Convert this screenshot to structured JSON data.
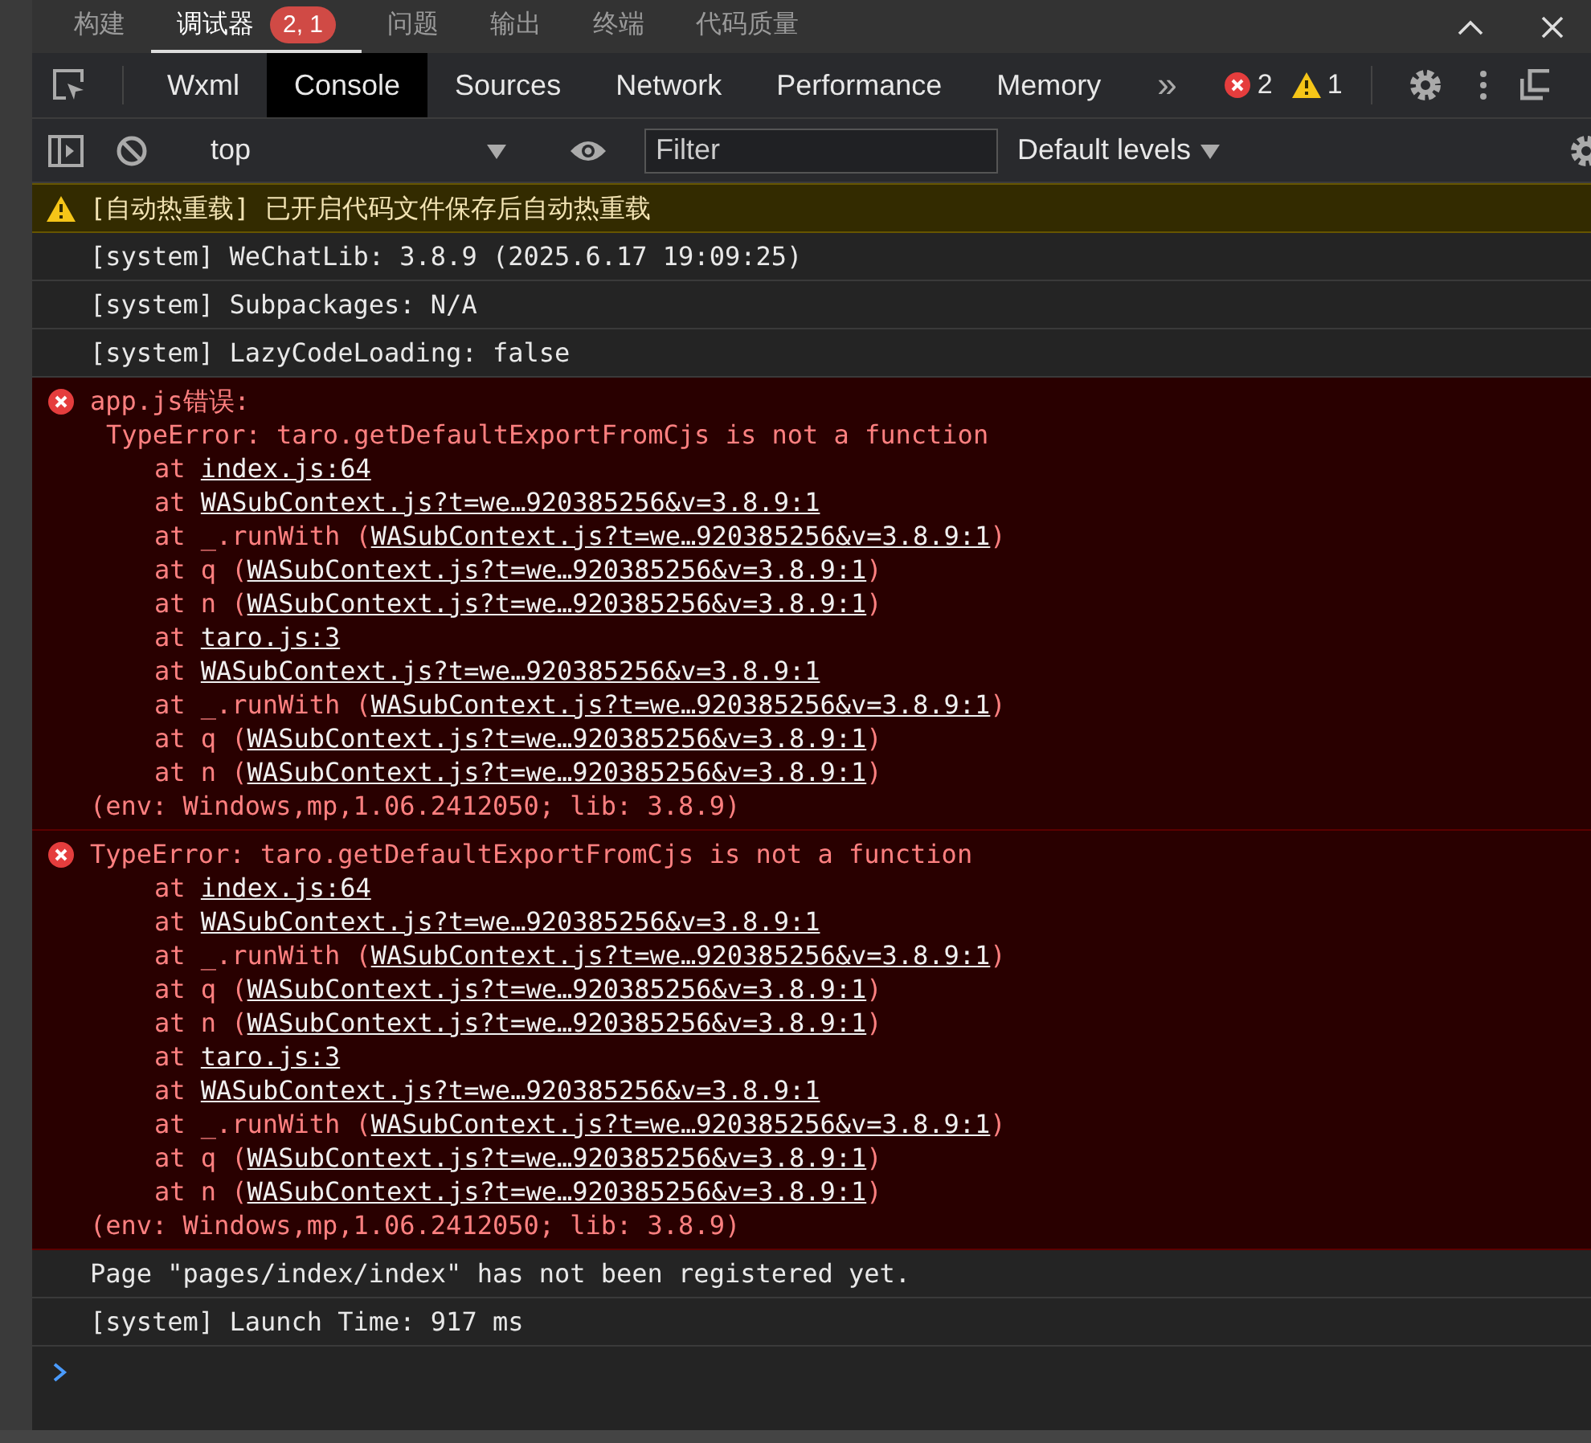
{
  "panel_tabs": [
    {
      "label": "构建",
      "selected": false
    },
    {
      "label": "调试器",
      "selected": true,
      "badge": "2, 1"
    },
    {
      "label": "问题",
      "selected": false
    },
    {
      "label": "输出",
      "selected": false
    },
    {
      "label": "终端",
      "selected": false
    },
    {
      "label": "代码质量",
      "selected": false
    }
  ],
  "devtools_tabs": [
    {
      "label": "Wxml",
      "selected": false
    },
    {
      "label": "Console",
      "selected": true
    },
    {
      "label": "Sources",
      "selected": false
    },
    {
      "label": "Network",
      "selected": false
    },
    {
      "label": "Performance",
      "selected": false
    },
    {
      "label": "Memory",
      "selected": false
    }
  ],
  "more_tabs": "»",
  "counts": {
    "errors": "2",
    "warnings": "1"
  },
  "console_toolbar": {
    "context": "top",
    "filter": {
      "placeholder": "Filter"
    },
    "levels": "Default levels"
  },
  "messages": [
    {
      "kind": "warning",
      "lines": [
        {
          "kind": "title",
          "text": "[自动热重载] 已开启代码文件保存后自动热重载"
        }
      ]
    },
    {
      "kind": "info",
      "lines": [
        {
          "kind": "title",
          "text": "[system] WeChatLib: 3.8.9 (2025.6.17 19:09:25)"
        }
      ]
    },
    {
      "kind": "info",
      "lines": [
        {
          "kind": "title",
          "text": "[system] Subpackages: N/A"
        }
      ]
    },
    {
      "kind": "info",
      "lines": [
        {
          "kind": "title",
          "text": "[system] LazyCodeLoading: false"
        }
      ]
    },
    {
      "kind": "error",
      "lines": [
        {
          "kind": "title",
          "text": "app.js错误:"
        },
        {
          "kind": "subtitle",
          "text": "TypeError: taro.getDefaultExportFromCjs is not a function"
        },
        {
          "kind": "frame",
          "before": "at ",
          "link": "index.js:64"
        },
        {
          "kind": "frame",
          "before": "at ",
          "link": "WASubContext.js?t=we…920385256&v=3.8.9:1"
        },
        {
          "kind": "frame",
          "before": "at _.runWith (",
          "link": "WASubContext.js?t=we…920385256&v=3.8.9:1",
          "after": ")"
        },
        {
          "kind": "frame",
          "before": "at q (",
          "link": "WASubContext.js?t=we…920385256&v=3.8.9:1",
          "after": ")"
        },
        {
          "kind": "frame",
          "before": "at n (",
          "link": "WASubContext.js?t=we…920385256&v=3.8.9:1",
          "after": ")"
        },
        {
          "kind": "frame",
          "before": "at ",
          "link": "taro.js:3"
        },
        {
          "kind": "frame",
          "before": "at ",
          "link": "WASubContext.js?t=we…920385256&v=3.8.9:1"
        },
        {
          "kind": "frame",
          "before": "at _.runWith (",
          "link": "WASubContext.js?t=we…920385256&v=3.8.9:1",
          "after": ")"
        },
        {
          "kind": "frame",
          "before": "at q (",
          "link": "WASubContext.js?t=we…920385256&v=3.8.9:1",
          "after": ")"
        },
        {
          "kind": "frame",
          "before": "at n (",
          "link": "WASubContext.js?t=we…920385256&v=3.8.9:1",
          "after": ")"
        },
        {
          "kind": "env",
          "text": "(env: Windows,mp,1.06.2412050; lib: 3.8.9)"
        }
      ]
    },
    {
      "kind": "error",
      "lines": [
        {
          "kind": "title",
          "text": "TypeError: taro.getDefaultExportFromCjs is not a function"
        },
        {
          "kind": "frame",
          "before": "at ",
          "link": "index.js:64"
        },
        {
          "kind": "frame",
          "before": "at ",
          "link": "WASubContext.js?t=we…920385256&v=3.8.9:1"
        },
        {
          "kind": "frame",
          "before": "at _.runWith (",
          "link": "WASubContext.js?t=we…920385256&v=3.8.9:1",
          "after": ")"
        },
        {
          "kind": "frame",
          "before": "at q (",
          "link": "WASubContext.js?t=we…920385256&v=3.8.9:1",
          "after": ")"
        },
        {
          "kind": "frame",
          "before": "at n (",
          "link": "WASubContext.js?t=we…920385256&v=3.8.9:1",
          "after": ")"
        },
        {
          "kind": "frame",
          "before": "at ",
          "link": "taro.js:3"
        },
        {
          "kind": "frame",
          "before": "at ",
          "link": "WASubContext.js?t=we…920385256&v=3.8.9:1"
        },
        {
          "kind": "frame",
          "before": "at _.runWith (",
          "link": "WASubContext.js?t=we…920385256&v=3.8.9:1",
          "after": ")"
        },
        {
          "kind": "frame",
          "before": "at q (",
          "link": "WASubContext.js?t=we…920385256&v=3.8.9:1",
          "after": ")"
        },
        {
          "kind": "frame",
          "before": "at n (",
          "link": "WASubContext.js?t=we…920385256&v=3.8.9:1",
          "after": ")"
        },
        {
          "kind": "env",
          "text": "(env: Windows,mp,1.06.2412050; lib: 3.8.9)"
        }
      ]
    },
    {
      "kind": "info",
      "lines": [
        {
          "kind": "title",
          "text": "Page \"pages/index/index\" has not been registered yet."
        }
      ]
    },
    {
      "kind": "info",
      "lines": [
        {
          "kind": "title",
          "text": "[system] Launch Time: 917 ms"
        }
      ]
    }
  ]
}
